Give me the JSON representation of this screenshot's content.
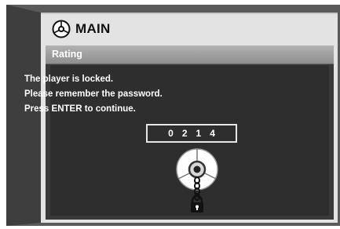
{
  "window": {
    "title": "MAIN"
  },
  "panel": {
    "title": "Rating"
  },
  "messages": [
    "The player is locked.",
    "Please remember the password.",
    "Press ENTER to continue."
  ],
  "password": {
    "digits": [
      "0",
      "2",
      "1",
      "4"
    ]
  },
  "icons": {
    "header": "disc-icon",
    "lock": "locked-disc-icon"
  },
  "colors": {
    "panel_bg": "#3a3a3a",
    "panel_bar": "#9a9a9a",
    "bezel": "#555555"
  }
}
